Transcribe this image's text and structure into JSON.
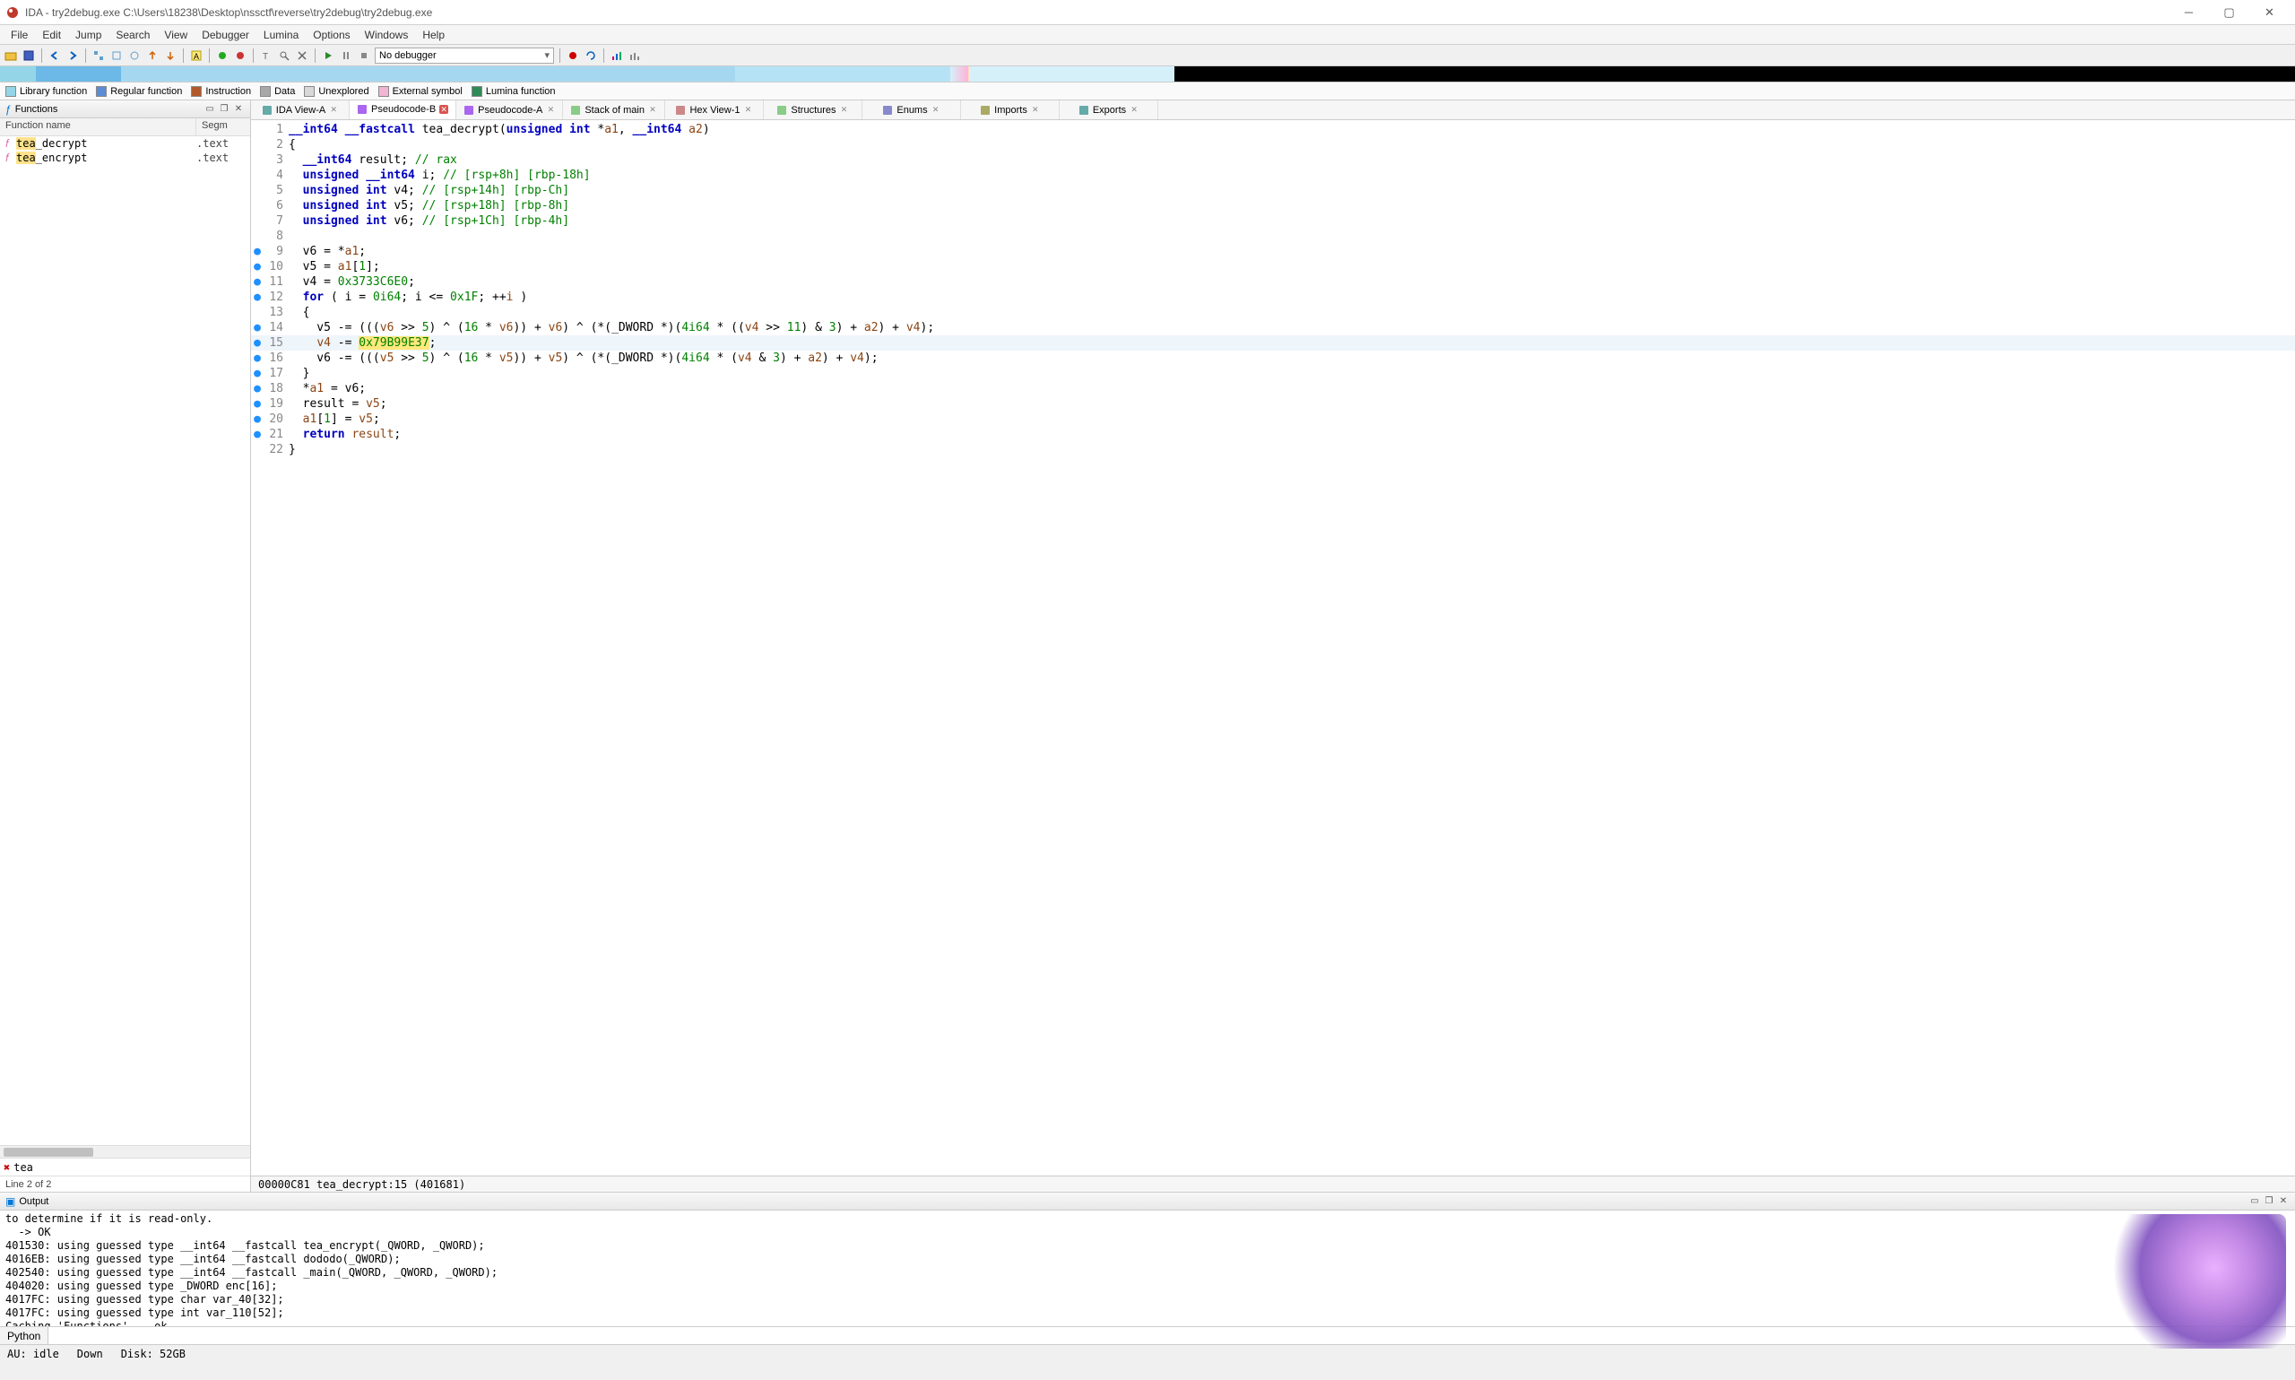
{
  "window": {
    "title": "IDA - try2debug.exe C:\\Users\\18238\\Desktop\\nssctf\\reverse\\try2debug\\try2debug.exe"
  },
  "menu": [
    "File",
    "Edit",
    "Jump",
    "Search",
    "View",
    "Debugger",
    "Lumina",
    "Options",
    "Windows",
    "Help"
  ],
  "toolbar": {
    "debugger_label": "No debugger"
  },
  "legend": [
    {
      "color": "#94d6e7",
      "label": "Library function"
    },
    {
      "color": "#5b8dd6",
      "label": "Regular function"
    },
    {
      "color": "#b05a2c",
      "label": "Instruction"
    },
    {
      "color": "#a8a8a8",
      "label": "Data"
    },
    {
      "color": "#d8d8d8",
      "label": "Unexplored"
    },
    {
      "color": "#f2b5d4",
      "label": "External symbol"
    },
    {
      "color": "#2e8b57",
      "label": "Lumina function"
    }
  ],
  "functions_panel": {
    "title": "Functions",
    "col1": "Function name",
    "col2": "Segm",
    "rows": [
      {
        "name_prefix": "tea",
        "name_rest": "_decrypt",
        "seg": ".text"
      },
      {
        "name_prefix": "tea",
        "name_rest": "_encrypt",
        "seg": ".text"
      }
    ],
    "filter": "tea",
    "line_status": "Line 2 of 2"
  },
  "tabs": [
    {
      "icon": "ida",
      "label": "IDA View-A",
      "close": "x"
    },
    {
      "icon": "pc",
      "label": "Pseudocode-B",
      "close": "red",
      "active": true
    },
    {
      "icon": "pc",
      "label": "Pseudocode-A",
      "close": "x"
    },
    {
      "icon": "st",
      "label": "Stack of main",
      "close": "x"
    },
    {
      "icon": "hx",
      "label": "Hex View-1",
      "close": "x"
    },
    {
      "icon": "st",
      "label": "Structures",
      "close": "x"
    },
    {
      "icon": "en",
      "label": "Enums",
      "close": "x"
    },
    {
      "icon": "im",
      "label": "Imports",
      "close": "x"
    },
    {
      "icon": "ex",
      "label": "Exports",
      "close": "x"
    }
  ],
  "code": {
    "lines": [
      {
        "n": 1,
        "bp": false,
        "html": "<span class='ty'>__int64</span> <span class='ty'>__fastcall</span> <span class='fnname'>tea_decrypt</span>(<span class='ty'>unsigned int</span> *<span class='var'>a1</span>, <span class='ty'>__int64</span> <span class='var'>a2</span>)"
      },
      {
        "n": 2,
        "bp": false,
        "html": "{"
      },
      {
        "n": 3,
        "bp": false,
        "html": "  <span class='ty'>__int64</span> result; <span class='cm'>// rax</span>"
      },
      {
        "n": 4,
        "bp": false,
        "html": "  <span class='ty'>unsigned __int64</span> i; <span class='cm'>// [rsp+8h] [rbp-18h]</span>"
      },
      {
        "n": 5,
        "bp": false,
        "html": "  <span class='ty'>unsigned int</span> v4; <span class='cm'>// [rsp+14h] [rbp-Ch]</span>"
      },
      {
        "n": 6,
        "bp": false,
        "html": "  <span class='ty'>unsigned int</span> v5; <span class='cm'>// [rsp+18h] [rbp-8h]</span>"
      },
      {
        "n": 7,
        "bp": false,
        "html": "  <span class='ty'>unsigned int</span> v6; <span class='cm'>// [rsp+1Ch] [rbp-4h]</span>"
      },
      {
        "n": 8,
        "bp": false,
        "html": ""
      },
      {
        "n": 9,
        "bp": true,
        "html": "  v6 = *<span class='var'>a1</span>;"
      },
      {
        "n": 10,
        "bp": true,
        "html": "  v5 = <span class='var'>a1</span>[<span class='num'>1</span>];"
      },
      {
        "n": 11,
        "bp": true,
        "html": "  v4 = <span class='num'>0x3733C6E0</span>;"
      },
      {
        "n": 12,
        "bp": true,
        "html": "  <span class='kw'>for</span> ( i = <span class='num'>0i64</span>; i &lt;= <span class='num'>0x1F</span>; ++<span class='var'>i</span> )"
      },
      {
        "n": 13,
        "bp": false,
        "html": "  {"
      },
      {
        "n": 14,
        "bp": true,
        "html": "    v5 -= (((<span class='var'>v6</span> &gt;&gt; <span class='num'>5</span>) ^ (<span class='num'>16</span> * <span class='var'>v6</span>)) + <span class='var'>v6</span>) ^ (*(_DWORD *)(<span class='num'>4i64</span> * ((<span class='var'>v4</span> &gt;&gt; <span class='num'>11</span>) &amp; <span class='num'>3</span>) + <span class='var'>a2</span>) + <span class='var'>v4</span>);"
      },
      {
        "n": 15,
        "bp": true,
        "cur": true,
        "html": "    <span class='var'>v4</span> -= <span class='hlnum'>0x79B99E37</span>;"
      },
      {
        "n": 16,
        "bp": true,
        "html": "    v6 -= (((<span class='var'>v5</span> &gt;&gt; <span class='num'>5</span>) ^ (<span class='num'>16</span> * <span class='var'>v5</span>)) + <span class='var'>v5</span>) ^ (*(_DWORD *)(<span class='num'>4i64</span> * (<span class='var'>v4</span> &amp; <span class='num'>3</span>) + <span class='var'>a2</span>) + <span class='var'>v4</span>);"
      },
      {
        "n": 17,
        "bp": true,
        "html": "  }"
      },
      {
        "n": 18,
        "bp": true,
        "html": "  *<span class='var'>a1</span> = v6;"
      },
      {
        "n": 19,
        "bp": true,
        "html": "  result = <span class='var'>v5</span>;"
      },
      {
        "n": 20,
        "bp": true,
        "html": "  <span class='var'>a1</span>[<span class='num'>1</span>] = <span class='var'>v5</span>;"
      },
      {
        "n": 21,
        "bp": true,
        "html": "  <span class='kw'>return</span> <span class='var'>result</span>;"
      },
      {
        "n": 22,
        "bp": false,
        "html": "}"
      }
    ],
    "status": "00000C81 tea_decrypt:15 (401681)"
  },
  "output": {
    "title": "Output",
    "lines": [
      "to determine if it is read-only.",
      "  -> OK",
      "401530: using guessed type __int64 __fastcall tea_encrypt(_QWORD, _QWORD);",
      "4016EB: using guessed type __int64 __fastcall dododo(_QWORD);",
      "402540: using guessed type __int64 __fastcall _main(_QWORD, _QWORD, _QWORD);",
      "404020: using guessed type _DWORD enc[16];",
      "4017FC: using guessed type char var_40[32];",
      "4017FC: using guessed type int var_110[52];",
      "Caching 'Functions'... ok"
    ],
    "lang": "Python"
  },
  "statusbar": {
    "au": "AU:  idle",
    "down": "Down",
    "disk": "Disk: 52GB"
  }
}
